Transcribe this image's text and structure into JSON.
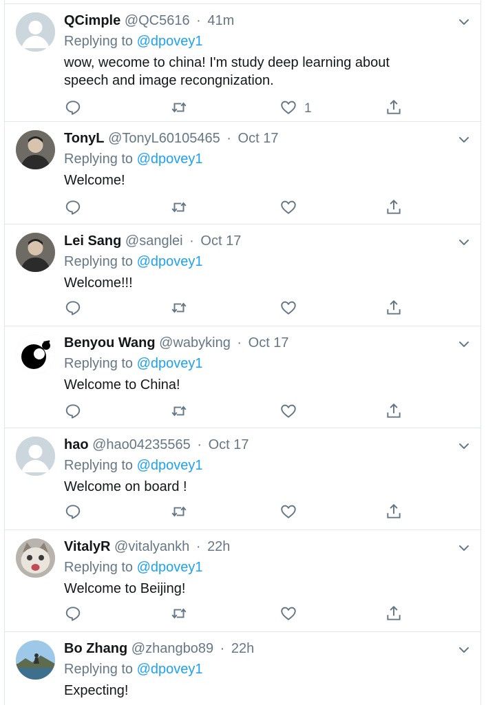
{
  "replying_prefix": "Replying to",
  "tweets": [
    {
      "name": "QCimple",
      "handle": "@QC5616",
      "time": "41m",
      "mention": "@dpovey1",
      "text": "wow, wecome to china! I'm study deep learning about speech and image recongnization.",
      "like_count": "1",
      "avatar": "default-avatar-icon"
    },
    {
      "name": "TonyL",
      "handle": "@TonyL60105465",
      "time": "Oct 17",
      "mention": "@dpovey1",
      "text": "Welcome!",
      "like_count": "",
      "avatar": "user-photo-avatar"
    },
    {
      "name": "Lei Sang",
      "handle": "@sanglei",
      "time": "Oct 17",
      "mention": "@dpovey1",
      "text": "Welcome!!!",
      "like_count": "",
      "avatar": "user-photo-avatar"
    },
    {
      "name": "Benyou Wang",
      "handle": "@wabyking",
      "time": "Oct 17",
      "mention": "@dpovey1",
      "text": "Welcome to China!",
      "like_count": "",
      "avatar": "black-logo-avatar"
    },
    {
      "name": "hao",
      "handle": "@hao04235565",
      "time": "Oct 17",
      "mention": "@dpovey1",
      "text": "Welcome on board !",
      "like_count": "",
      "avatar": "default-avatar-icon"
    },
    {
      "name": "VitalyR",
      "handle": "@vitalyankh",
      "time": "22h",
      "mention": "@dpovey1",
      "text": "Welcome to Beijing!",
      "like_count": "",
      "avatar": "cat-photo-avatar"
    },
    {
      "name": "Bo Zhang",
      "handle": "@zhangbo89",
      "time": "22h",
      "mention": "@dpovey1",
      "text": "Expecting!",
      "like_count": "",
      "avatar": "landscape-photo-avatar"
    }
  ],
  "colors": {
    "text": "#14171a",
    "secondary": "#657786",
    "link": "#1da1f2",
    "border": "#e1e8ed"
  }
}
